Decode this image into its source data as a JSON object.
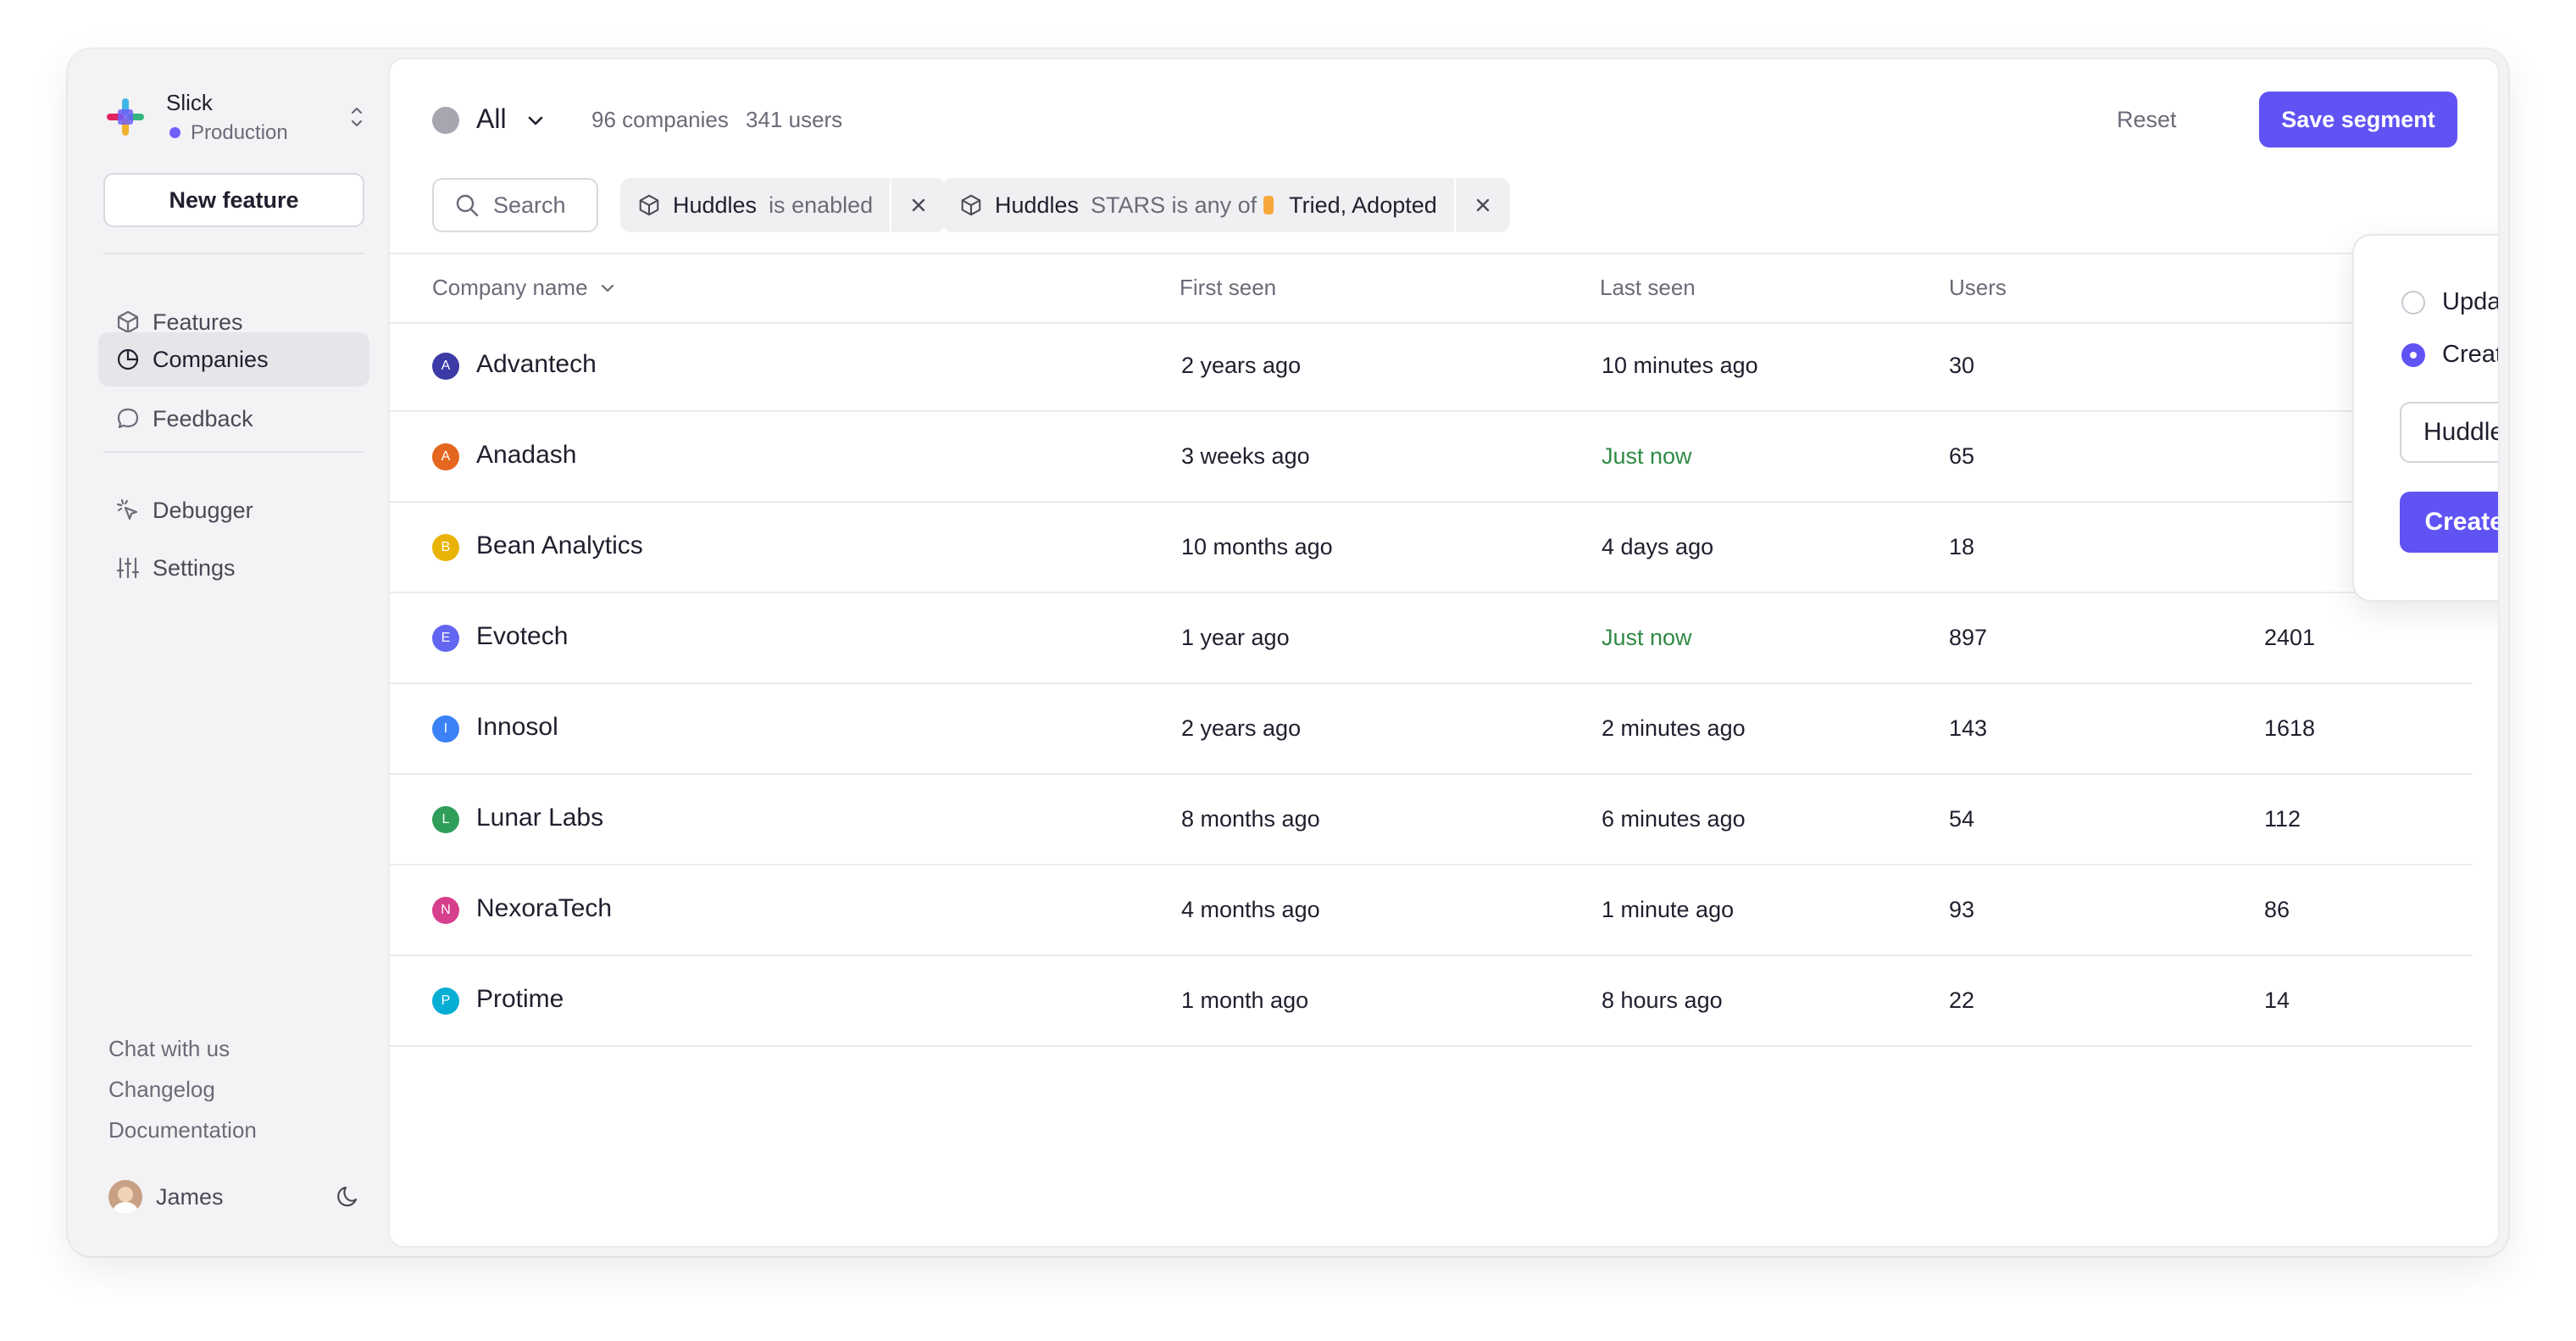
{
  "app": {
    "workspace_name": "Slick",
    "environment": "Production",
    "new_feature_label": "New feature"
  },
  "nav": {
    "primary": [
      {
        "label": "Features",
        "icon": "cube-icon",
        "active": false
      },
      {
        "label": "Companies",
        "icon": "pie-chart-icon",
        "active": true
      },
      {
        "label": "Feedback",
        "icon": "chat-bubble-icon",
        "active": false
      }
    ],
    "secondary": [
      {
        "label": "Debugger",
        "icon": "cursor-click-icon"
      },
      {
        "label": "Settings",
        "icon": "sliders-icon"
      }
    ],
    "footer_links": [
      "Chat with us",
      "Changelog",
      "Documentation"
    ],
    "user_name": "James"
  },
  "header": {
    "segment_name": "All",
    "companies_count": "96 companies",
    "users_count": "341 users",
    "reset_label": "Reset",
    "save_label": "Save segment"
  },
  "filters": {
    "search_placeholder": "Search",
    "chips": [
      {
        "feature": "Huddles",
        "condition": "is enabled"
      },
      {
        "feature": "Huddles",
        "condition": "STARS is any of",
        "values": "Tried, Adopted"
      }
    ]
  },
  "table": {
    "columns": [
      "Company name",
      "First seen",
      "Last seen",
      "Users"
    ],
    "rows": [
      {
        "initial": "A",
        "color": "#3b3aa6",
        "name": "Advantech",
        "first_seen": "2 years ago",
        "last_seen": "10 minutes ago",
        "recent": false,
        "users": "30",
        "extra": ""
      },
      {
        "initial": "A",
        "color": "#e4661f",
        "name": "Anadash",
        "first_seen": "3 weeks ago",
        "last_seen": "Just now",
        "recent": true,
        "users": "65",
        "extra": ""
      },
      {
        "initial": "B",
        "color": "#eab308",
        "name": "Bean Analytics",
        "first_seen": "10 months ago",
        "last_seen": "4 days ago",
        "recent": false,
        "users": "18",
        "extra": ""
      },
      {
        "initial": "E",
        "color": "#6366f1",
        "name": "Evotech",
        "first_seen": "1 year ago",
        "last_seen": "Just now",
        "recent": true,
        "users": "897",
        "extra": "2401"
      },
      {
        "initial": "I",
        "color": "#3b82f6",
        "name": "Innosol",
        "first_seen": "2 years ago",
        "last_seen": "2 minutes ago",
        "recent": false,
        "users": "143",
        "extra": "1618"
      },
      {
        "initial": "L",
        "color": "#2f9e5b",
        "name": "Lunar Labs",
        "first_seen": "8 months ago",
        "last_seen": "6 minutes ago",
        "recent": false,
        "users": "54",
        "extra": "112"
      },
      {
        "initial": "N",
        "color": "#d63f8c",
        "name": "NexoraTech",
        "first_seen": "4 months ago",
        "last_seen": "1 minute ago",
        "recent": false,
        "users": "93",
        "extra": "86"
      },
      {
        "initial": "P",
        "color": "#06aed4",
        "name": "Protime",
        "first_seen": "1 month ago",
        "last_seen": "8 hours ago",
        "recent": false,
        "users": "22",
        "extra": "14"
      }
    ]
  },
  "popover": {
    "option_update": "Update segment",
    "option_create": "Create a new segment",
    "selected": "create",
    "segment_name_value": "Huddles Users",
    "create_label": "Create segment"
  },
  "colors": {
    "accent": "#6053f4",
    "recent_text": "#2f8a45",
    "stars_chip": "#f6a83d"
  }
}
